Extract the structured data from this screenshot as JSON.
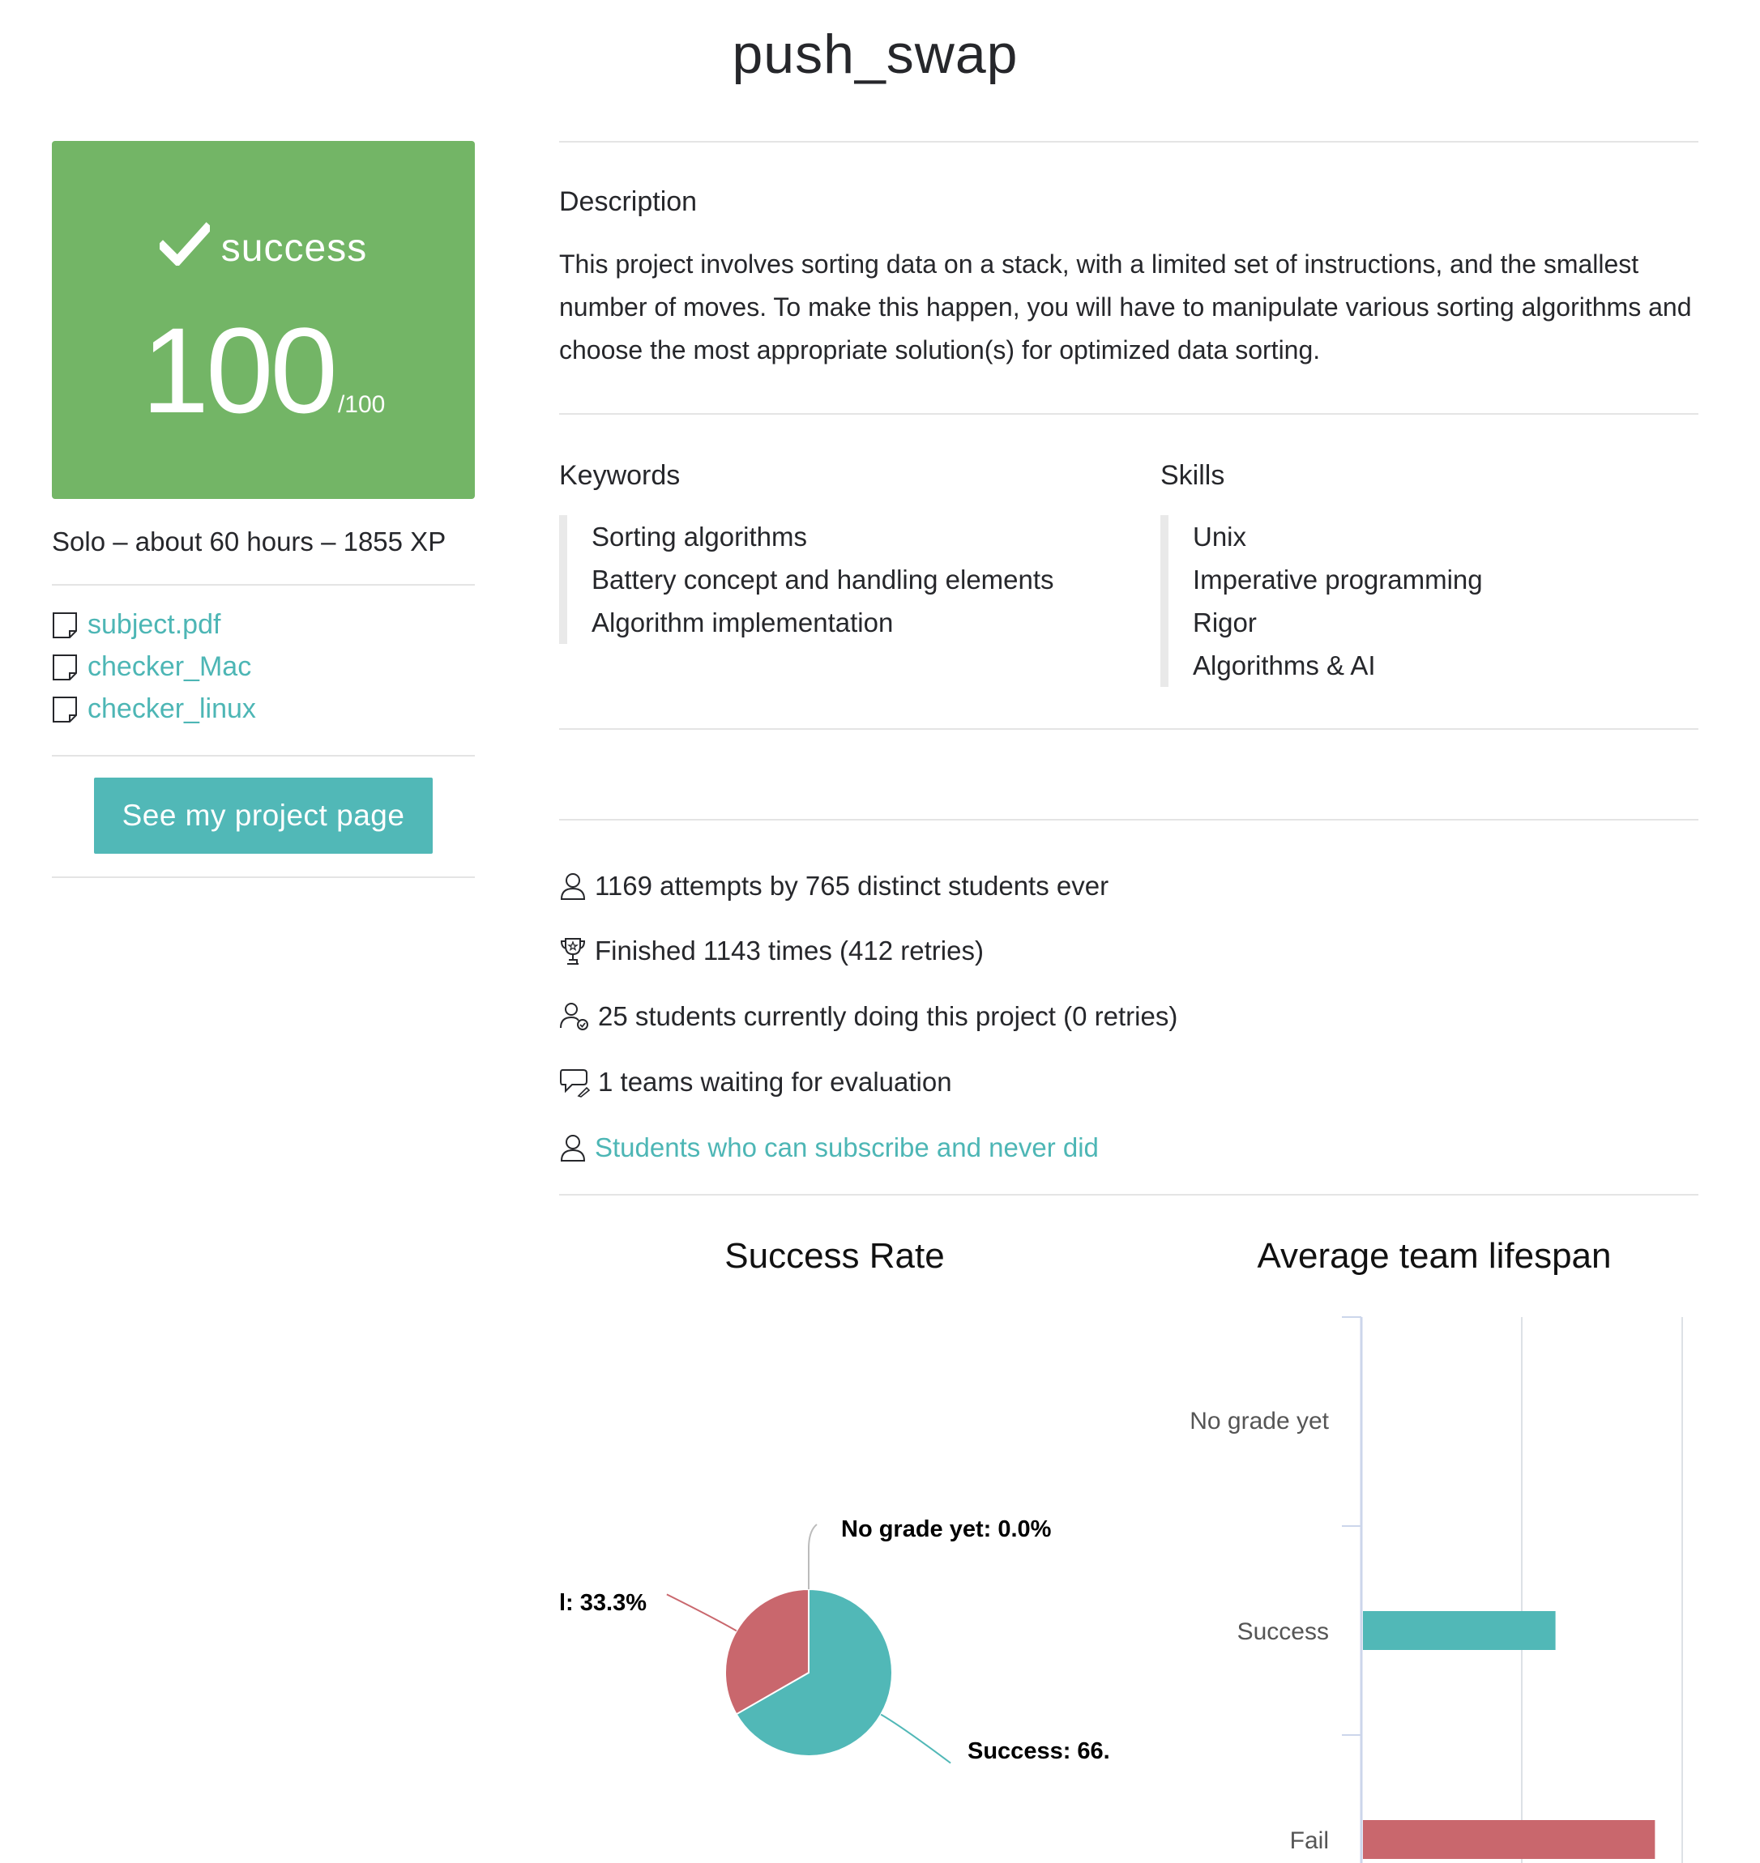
{
  "project": {
    "title": "push_swap",
    "status": "success",
    "grade": "100",
    "grade_max": "/100",
    "meta": "Solo – about 60 hours – 1855 XP"
  },
  "files": [
    {
      "name": "subject.pdf",
      "icon": "document-icon"
    },
    {
      "name": "checker_Mac",
      "icon": "document-icon"
    },
    {
      "name": "checker_linux",
      "icon": "document-icon"
    }
  ],
  "actions": {
    "project_page": "See my project page"
  },
  "description": {
    "heading": "Description",
    "text": "This project involves sorting data on a stack, with a limited set of instructions, and the smallest number of moves. To make this happen, you will have to manipulate various sorting algorithms and choose the most appropriate solution(s) for optimized data sorting."
  },
  "keywords": {
    "heading": "Keywords",
    "items": [
      "Sorting algorithms",
      "Battery concept and handling elements",
      "Algorithm implementation"
    ]
  },
  "skills": {
    "heading": "Skills",
    "items": [
      "Unix",
      "Imperative programming",
      "Rigor",
      "Algorithms & AI"
    ]
  },
  "stats": [
    {
      "text": "1169 attempts by 765 distinct students ever",
      "icon": "user-icon"
    },
    {
      "text": "Finished 1143 times (412 retries)",
      "icon": "trophy-icon"
    },
    {
      "text": "25 students currently doing this project (0 retries)",
      "icon": "user-check-icon"
    },
    {
      "text": "1 teams waiting for evaluation",
      "icon": "speech-bubble-icon"
    },
    {
      "text": "Students who can subscribe and never did",
      "icon": "user-icon"
    }
  ],
  "colors": {
    "success": "#51b8b7",
    "fail": "#c9676d",
    "grade_box": "#73b566",
    "link": "#4db6b5"
  },
  "chart_data": [
    {
      "type": "pie",
      "title": "Success Rate",
      "slices": [
        {
          "name": "Success",
          "value": 66.7,
          "label": "Success: 66.",
          "color": "#51b8b7"
        },
        {
          "name": "Fail",
          "value": 33.3,
          "label": "l: 33.3%",
          "color": "#c9676d"
        },
        {
          "name": "No grade yet",
          "value": 0.0,
          "label": "No grade yet: 0.0%",
          "color": "#cccccc"
        }
      ]
    },
    {
      "type": "bar",
      "orientation": "horizontal",
      "title": "Average team lifespan",
      "categories": [
        "No grade yet",
        "Success",
        "Fail"
      ],
      "values": [
        0,
        1.2,
        1.82
      ],
      "colors": [
        "#cccccc",
        "#51b8b7",
        "#c9676d"
      ],
      "xlim": [
        0,
        2
      ]
    }
  ]
}
